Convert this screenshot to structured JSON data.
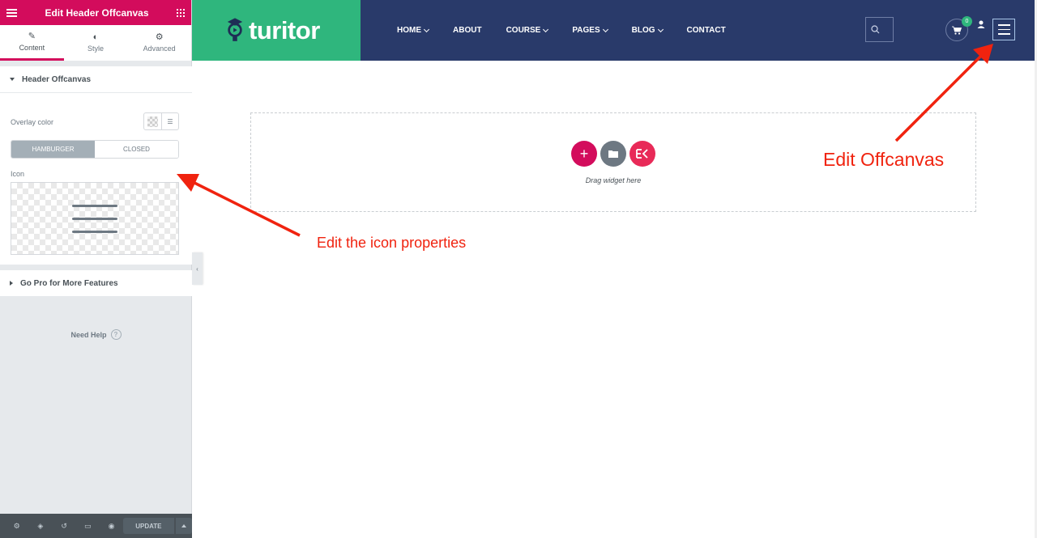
{
  "panel": {
    "title": "Edit Header Offcanvas",
    "tabs": [
      {
        "label": "Content",
        "icon": "pencil-icon"
      },
      {
        "label": "Style",
        "icon": "contrast-icon"
      },
      {
        "label": "Advanced",
        "icon": "gear-icon"
      }
    ],
    "section_offcanvas": {
      "title": "Header Offcanvas",
      "overlay_label": "Overlay color",
      "switch_options": [
        "HAMBURGER",
        "CLOSED"
      ],
      "switch_active": "HAMBURGER",
      "icon_label": "Icon"
    },
    "section_gopro": {
      "title": "Go Pro for More Features"
    },
    "need_help": "Need Help",
    "need_help_icon": "?",
    "footer": {
      "update_label": "UPDATE"
    }
  },
  "site": {
    "logo_text": "turitor",
    "nav": [
      {
        "label": "HOME",
        "dropdown": true
      },
      {
        "label": "ABOUT",
        "dropdown": false
      },
      {
        "label": "COURSE",
        "dropdown": true
      },
      {
        "label": "PAGES",
        "dropdown": true
      },
      {
        "label": "BLOG",
        "dropdown": true
      },
      {
        "label": "CONTACT",
        "dropdown": false
      }
    ],
    "cart_count": "0",
    "header_color": "#293a6a",
    "logo_bg_color": "#2fb67d"
  },
  "dropzone": {
    "text": "Drag widget here",
    "buttons": [
      {
        "icon": "plus-icon",
        "color": "#d30c5c"
      },
      {
        "icon": "folder-icon",
        "color": "#6d7882"
      },
      {
        "icon": "elementskit-icon",
        "color": "#e82a58"
      }
    ]
  },
  "annotations": {
    "icon_properties": "Edit the icon properties",
    "offcanvas": "Edit Offcanvas",
    "color": "#f0230f"
  }
}
